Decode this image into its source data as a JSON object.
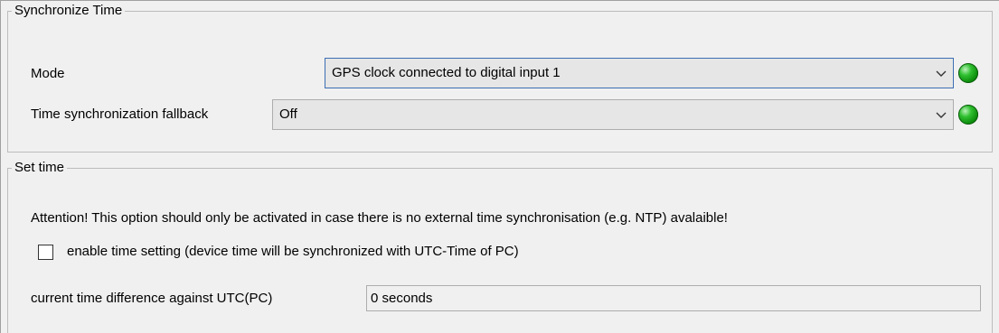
{
  "sync_group": {
    "legend": "Synchronize Time",
    "mode_label": "Mode",
    "mode_value": "GPS clock connected to digital input 1",
    "fallback_label": "Time synchronization fallback",
    "fallback_value": "Off",
    "status_color": "#1fa31f"
  },
  "set_time_group": {
    "legend": "Set time",
    "attention_text": "Attention! This option should only be activated in case there is no external time synchronisation (e.g. NTP) avalaible!",
    "enable_checkbox_label": "enable time setting (device time will be synchronized with UTC-Time of PC)",
    "enable_checked": false,
    "difference_label": "current time difference against UTC(PC)",
    "difference_value": "0 seconds"
  }
}
